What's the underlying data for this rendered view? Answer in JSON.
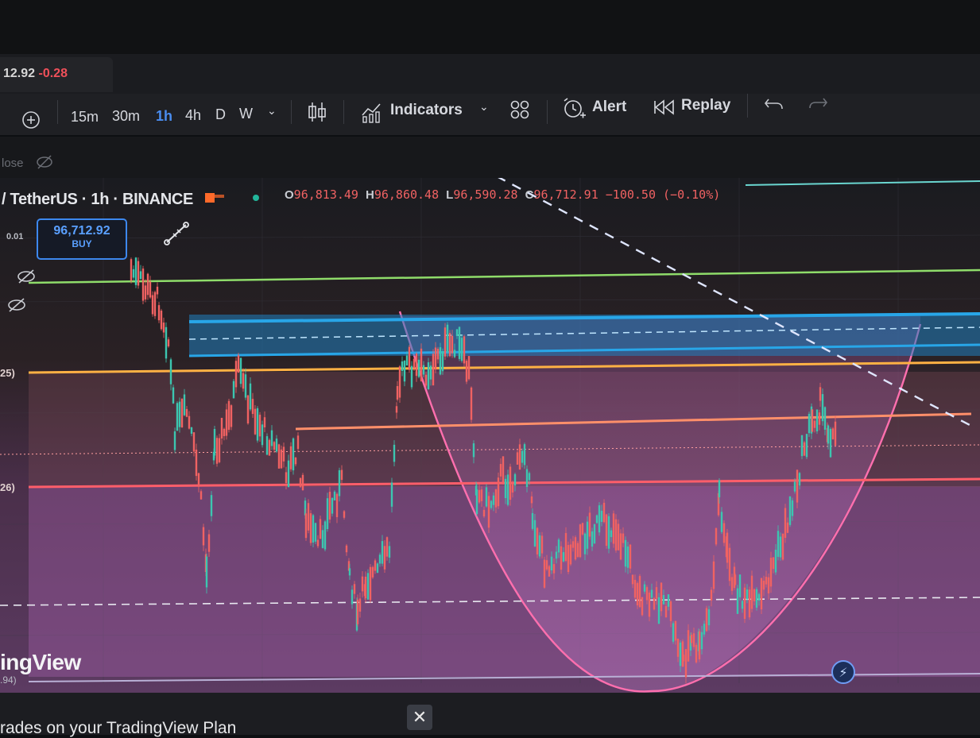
{
  "header": {
    "ticker_price": "12.92",
    "ticker_change": "-0.28"
  },
  "toolbar": {
    "timeframes": [
      "15m",
      "30m",
      "1h",
      "4h",
      "D",
      "W"
    ],
    "active_timeframe": "1h",
    "indicators_label": "Indicators",
    "alert_label": "Alert",
    "replay_label": "Replay"
  },
  "subbar": {
    "close_label": "lose"
  },
  "legend": {
    "symbol": "/ TetherUS · 1h · BINANCE",
    "open_key": "O",
    "open": "96,813.49",
    "high_key": "H",
    "high": "96,860.48",
    "low_key": "L",
    "low": "96,590.28",
    "close_key": "C",
    "close": "96,712.91",
    "change": "−100.50 (−0.10%)"
  },
  "order": {
    "quantity": "0.01",
    "price": "96,712.92",
    "side": "BUY"
  },
  "axis_ticks": {
    "upper": "25)",
    "lower": "26)",
    "bottom": ".94)"
  },
  "branding": {
    "logo_text": "ingView",
    "promo_text": "rades on your TradingView Plan"
  },
  "colors": {
    "buy_blue": "#3d88ee",
    "down_red": "#f06262",
    "up_teal": "#3cc6b0",
    "bowl_pink": "#ff6fae",
    "zone_blue": "#28a6e8",
    "level_orange": "#ff9a3c",
    "level_green": "#8fdc6a"
  },
  "icons": {
    "crosshair": "crosshair-icon",
    "candles": "candlestick-icon",
    "indicators": "indicators-icon",
    "layout": "layout-grid-icon",
    "alert": "alarm-clock-icon",
    "replay": "replay-icon",
    "undo": "undo-icon",
    "redo": "redo-icon",
    "hide": "eye-off-icon",
    "ruler": "ruler-icon",
    "close": "close-icon",
    "bolt": "lightning-icon"
  }
}
